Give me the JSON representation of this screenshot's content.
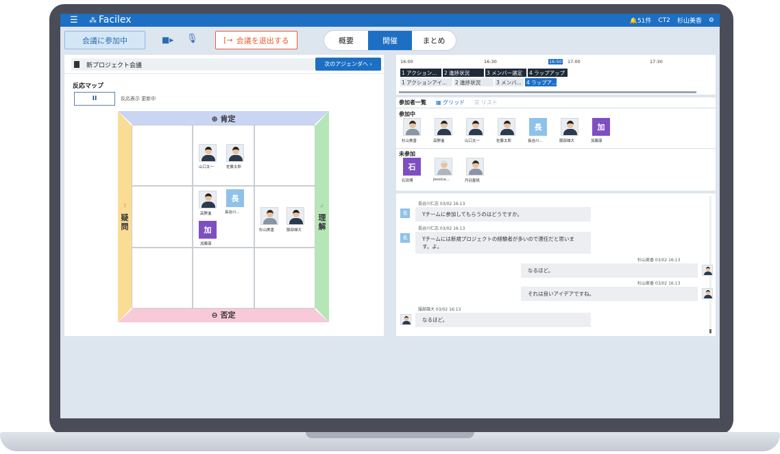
{
  "header": {
    "app_name": "Facilex",
    "notifications": "51件",
    "org": "CT2",
    "user": "杉山美香"
  },
  "toolbar": {
    "joined_label": "会議に参加中",
    "leave_label": "会議を退出する",
    "tabs": [
      {
        "label": "概要",
        "active": false
      },
      {
        "label": "開催",
        "active": true
      },
      {
        "label": "まとめ",
        "active": false
      }
    ]
  },
  "meeting": {
    "title": "新プロジェクト会議",
    "next_agenda": "次のアジェンダへ ›"
  },
  "reaction_map": {
    "label": "反応マップ",
    "pause_label": "II",
    "status": "反応表示 更新中",
    "axes": {
      "top": "肯定",
      "bottom": "否定",
      "left": "疑問",
      "right": "理解"
    },
    "names": {
      "yamaguchi": "山口太一",
      "sato": "佐藤太郎",
      "takano": "高野進",
      "hasegawa": "長谷川...",
      "kato": "加藤康",
      "sugiyama": "杉山美香",
      "hattori": "服部雄大"
    },
    "badges": {
      "hasegawa": "長",
      "kato": "加"
    }
  },
  "timeline": {
    "ticks": [
      "16:00",
      "16:30",
      "16:50",
      "17:00",
      "17:30"
    ],
    "planned": [
      "1 アクション...",
      "2 進捗状況",
      "3 メンバー選定",
      "4 ラップアップ"
    ],
    "actual": [
      "1 アクションアイ...",
      "2 進捗状況",
      "3 メンバ...",
      "4 ラップア..."
    ]
  },
  "participants": {
    "title": "参加者一覧",
    "grid_label": "グリッド",
    "list_label": "リスト",
    "joined_label": "参加中",
    "not_joined_label": "未参加",
    "joined": [
      {
        "name": "杉山美香",
        "type": "lady"
      },
      {
        "name": "高野進",
        "type": "man"
      },
      {
        "name": "山口太一",
        "type": "man"
      },
      {
        "name": "佐藤太郎",
        "type": "man"
      },
      {
        "name": "長谷川...",
        "type": "badge",
        "initial": "長"
      },
      {
        "name": "服部雄大",
        "type": "man"
      },
      {
        "name": "加藤康",
        "type": "badge-purple",
        "initial": "加"
      }
    ],
    "not_joined": [
      {
        "name": "石田博",
        "type": "badge-purple",
        "initial": "石"
      },
      {
        "name": "Jessica...",
        "type": "gray"
      },
      {
        "name": "丹羽夏帆",
        "type": "lady"
      }
    ]
  },
  "chat": {
    "messages": [
      {
        "sender": "長谷川仁志",
        "time": "03/02 16:13",
        "text": "Yチームに参加してもらうのはどうですか。",
        "side": "left",
        "initial": "長"
      },
      {
        "sender": "長谷川仁志",
        "time": "03/02 16:13",
        "text": "Yチームには新規プロジェクトの経験者が多いので適任だと思います。よ。",
        "side": "left",
        "initial": "長"
      },
      {
        "sender": "杉山美香",
        "time": "03/02 16:13",
        "text": "なるほど。",
        "side": "right"
      },
      {
        "sender": "杉山美香",
        "time": "03/02 16:13",
        "text": "それは良いアイデアですね。",
        "side": "right"
      },
      {
        "sender": "服部雄大",
        "time": "03/02 16:13",
        "text": "なるほど。",
        "side": "left"
      }
    ]
  },
  "colors": {
    "brand": "#1d6fc4",
    "leave": "#e85c2a",
    "positive": "#c9d5f2",
    "negative": "#f8c9d9",
    "question": "#fbdc95",
    "understand": "#b6e6b8"
  }
}
